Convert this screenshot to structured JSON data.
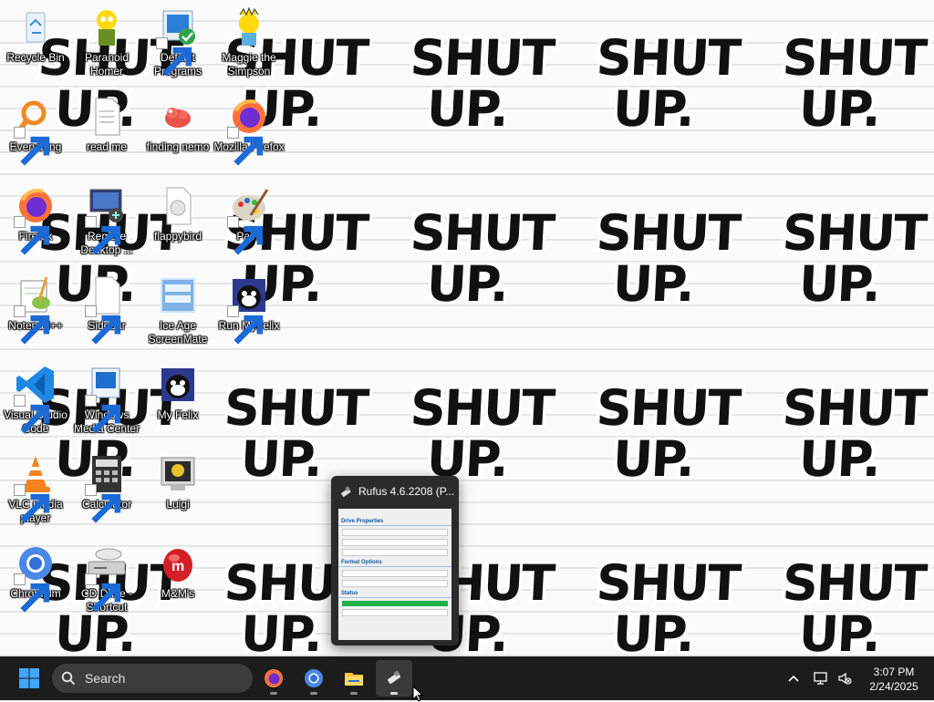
{
  "wallpaper": {
    "text": "SHUT UP."
  },
  "desktop_icons": [
    {
      "label": "Recycle Bin"
    },
    {
      "label": "Paranoid Homer"
    },
    {
      "label": "Default Programs"
    },
    {
      "label": "Maggie the Simpson"
    },
    {
      "label": "Everything"
    },
    {
      "label": "read me"
    },
    {
      "label": "finding nemo"
    },
    {
      "label": "Mozilla Firefox"
    },
    {
      "label": "Firefox"
    },
    {
      "label": "Remote Desktop ..."
    },
    {
      "label": "flappybird"
    },
    {
      "label": "Paint"
    },
    {
      "label": "Notepad++"
    },
    {
      "label": "Sidebar"
    },
    {
      "label": "Ice Age ScreenMate"
    },
    {
      "label": "Run MyFelix"
    },
    {
      "label": "Visual Studio Code"
    },
    {
      "label": "Windows Media Center"
    },
    {
      "label": "My Felix"
    },
    {
      "label": "VLC media player"
    },
    {
      "label": "Calculator"
    },
    {
      "label": "Luigi"
    },
    {
      "label": "Chromium"
    },
    {
      "label": "CD Drive - Shortcut"
    },
    {
      "label": "M&M's"
    }
  ],
  "preview": {
    "title": "Rufus 4.6.2208 (P...",
    "thumb_sections": [
      "Drive Properties",
      "Format Options",
      "Status"
    ]
  },
  "taskbar": {
    "search_label": "Search",
    "apps": [
      "start-icon",
      "firefox-icon",
      "chromium-icon",
      "file-explorer-icon",
      "rufus-icon"
    ]
  },
  "clock": {
    "time": "3:07 PM",
    "date": "2/24/2025"
  },
  "colors": {
    "taskbar": "#1c1c1c",
    "accent": "#0078d4"
  }
}
